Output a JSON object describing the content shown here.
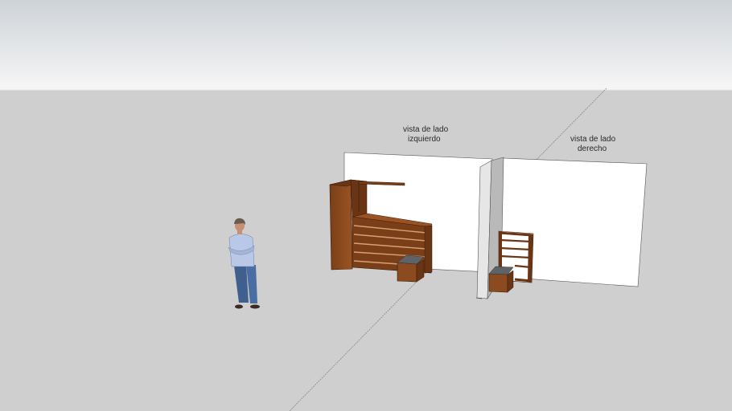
{
  "scene": {
    "sky_top_color": "#ced3d8",
    "sky_bottom_color": "#f6f6f6",
    "ground_color": "#cfcfcf",
    "wood_color": "#8b4a1f",
    "wall_color": "#ffffff"
  },
  "annotations": {
    "left_view": {
      "line1": "vista de lado",
      "line2": "izquierdo"
    },
    "right_view": {
      "line1": "vista de lado",
      "line2": "derecho"
    }
  }
}
